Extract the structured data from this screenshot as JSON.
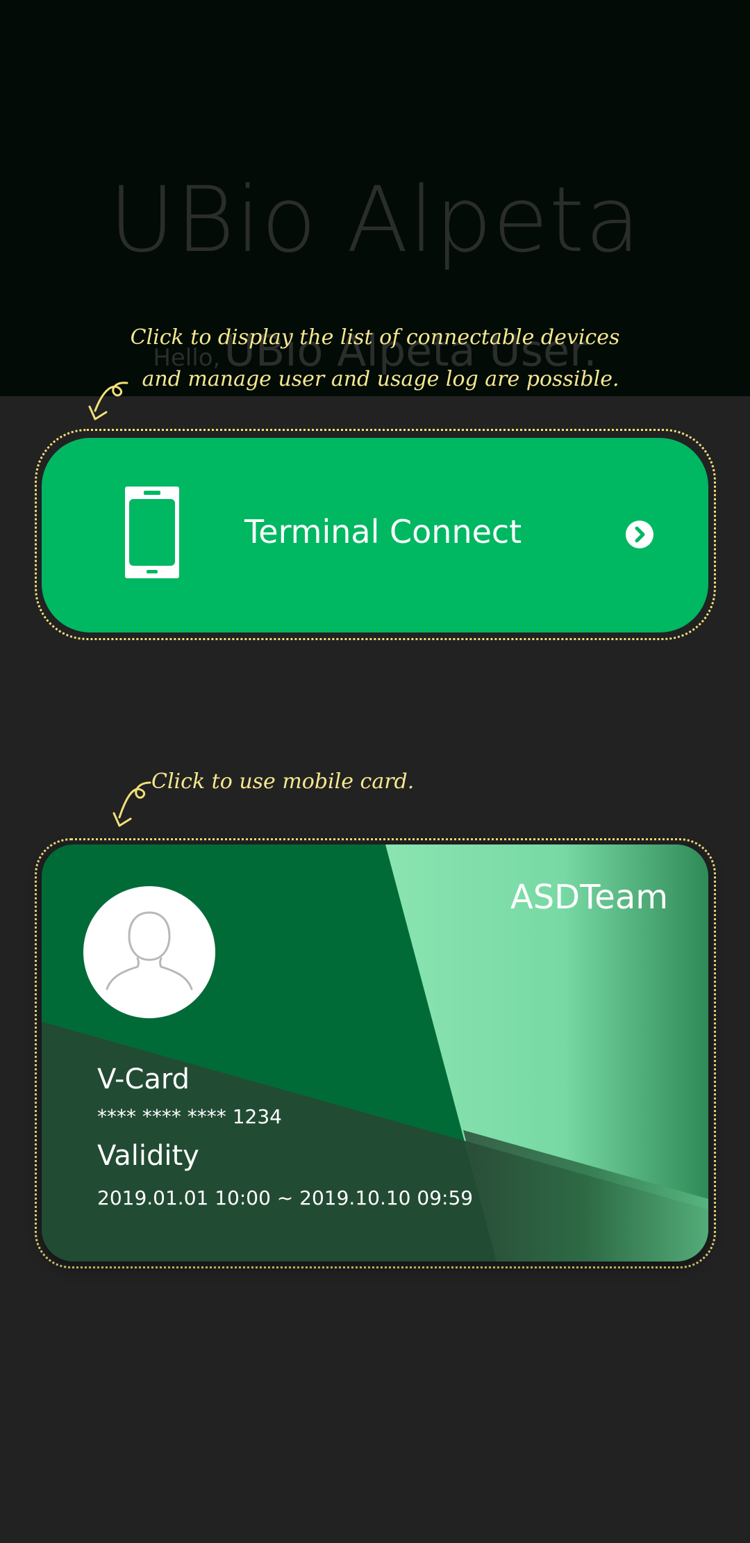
{
  "header": {
    "app_title": "UBio Alpeta",
    "greeting_prefix": "Hello,",
    "greeting_user": "UBio Alpeta User."
  },
  "hints": {
    "terminal_line1": "Click to display the list of connectable devices",
    "terminal_line2": "and manage user and usage log are possible.",
    "card": "Click to use mobile card."
  },
  "terminal": {
    "label": "Terminal Connect",
    "icon": "phone-icon",
    "action_icon": "chevron-right-circle-icon",
    "color": "#00b762"
  },
  "card": {
    "team": "ASDTeam",
    "name": "V-Card",
    "number": "**** **** **** 1234",
    "validity_label": "Validity",
    "validity_value": "2019.01.01 10:00 ~ 2019.10.10 09:59",
    "avatar_icon": "user-avatar-icon",
    "colors": {
      "base": "#016b37",
      "light": "#7ddea6",
      "dark": "#244a33"
    }
  },
  "overlay": {
    "outline_color": "#f2e079",
    "text_color": "#f6e88f"
  }
}
